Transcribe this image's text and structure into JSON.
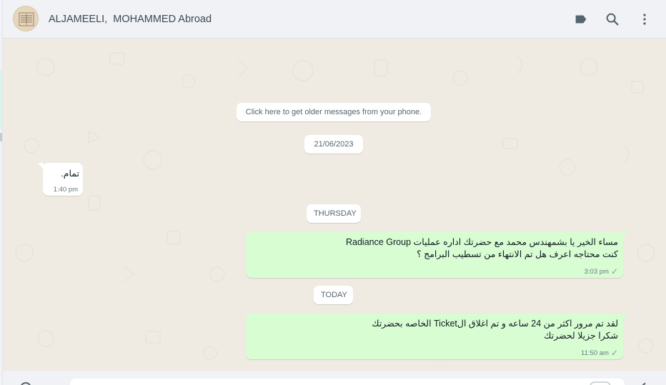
{
  "header": {
    "contact_name": "ALJAMEELI,  MOHAMMED Abroad",
    "icons": [
      "label-icon",
      "search-icon",
      "menu-icon"
    ]
  },
  "chat": {
    "older_messages_notice": "Click here to get older messages from your phone.",
    "date_separators": {
      "first": "21/06/2023",
      "second": "THURSDAY",
      "third": "TODAY"
    },
    "messages": [
      {
        "direction": "incoming",
        "lines": [
          "تمام."
        ],
        "time": "1:40 pm"
      },
      {
        "direction": "outgoing",
        "lines": [
          "مساء الخير يا بشمهندس محمد مع حضرتك اداره عمليات Radiance Group",
          "كنت محتاجه اعرف هل تم الانتهاء من تسطيب البرامج ؟"
        ],
        "time": "3:03 pm",
        "status": "✓"
      },
      {
        "direction": "outgoing",
        "lines": [
          "لقد تم مرور اكثر من 24 ساعه و تم اغلاق الTicket الخاصه بحضرتك",
          "شكرا جزيلا لحضرتك"
        ],
        "time": "11:50 am",
        "status": "✓"
      }
    ]
  },
  "colors": {
    "header_bg": "#f0f2f5",
    "chat_bg": "#efeae2",
    "outgoing_bubble": "#d9fdd3",
    "incoming_bubble": "#ffffff",
    "icon": "#54656f"
  }
}
